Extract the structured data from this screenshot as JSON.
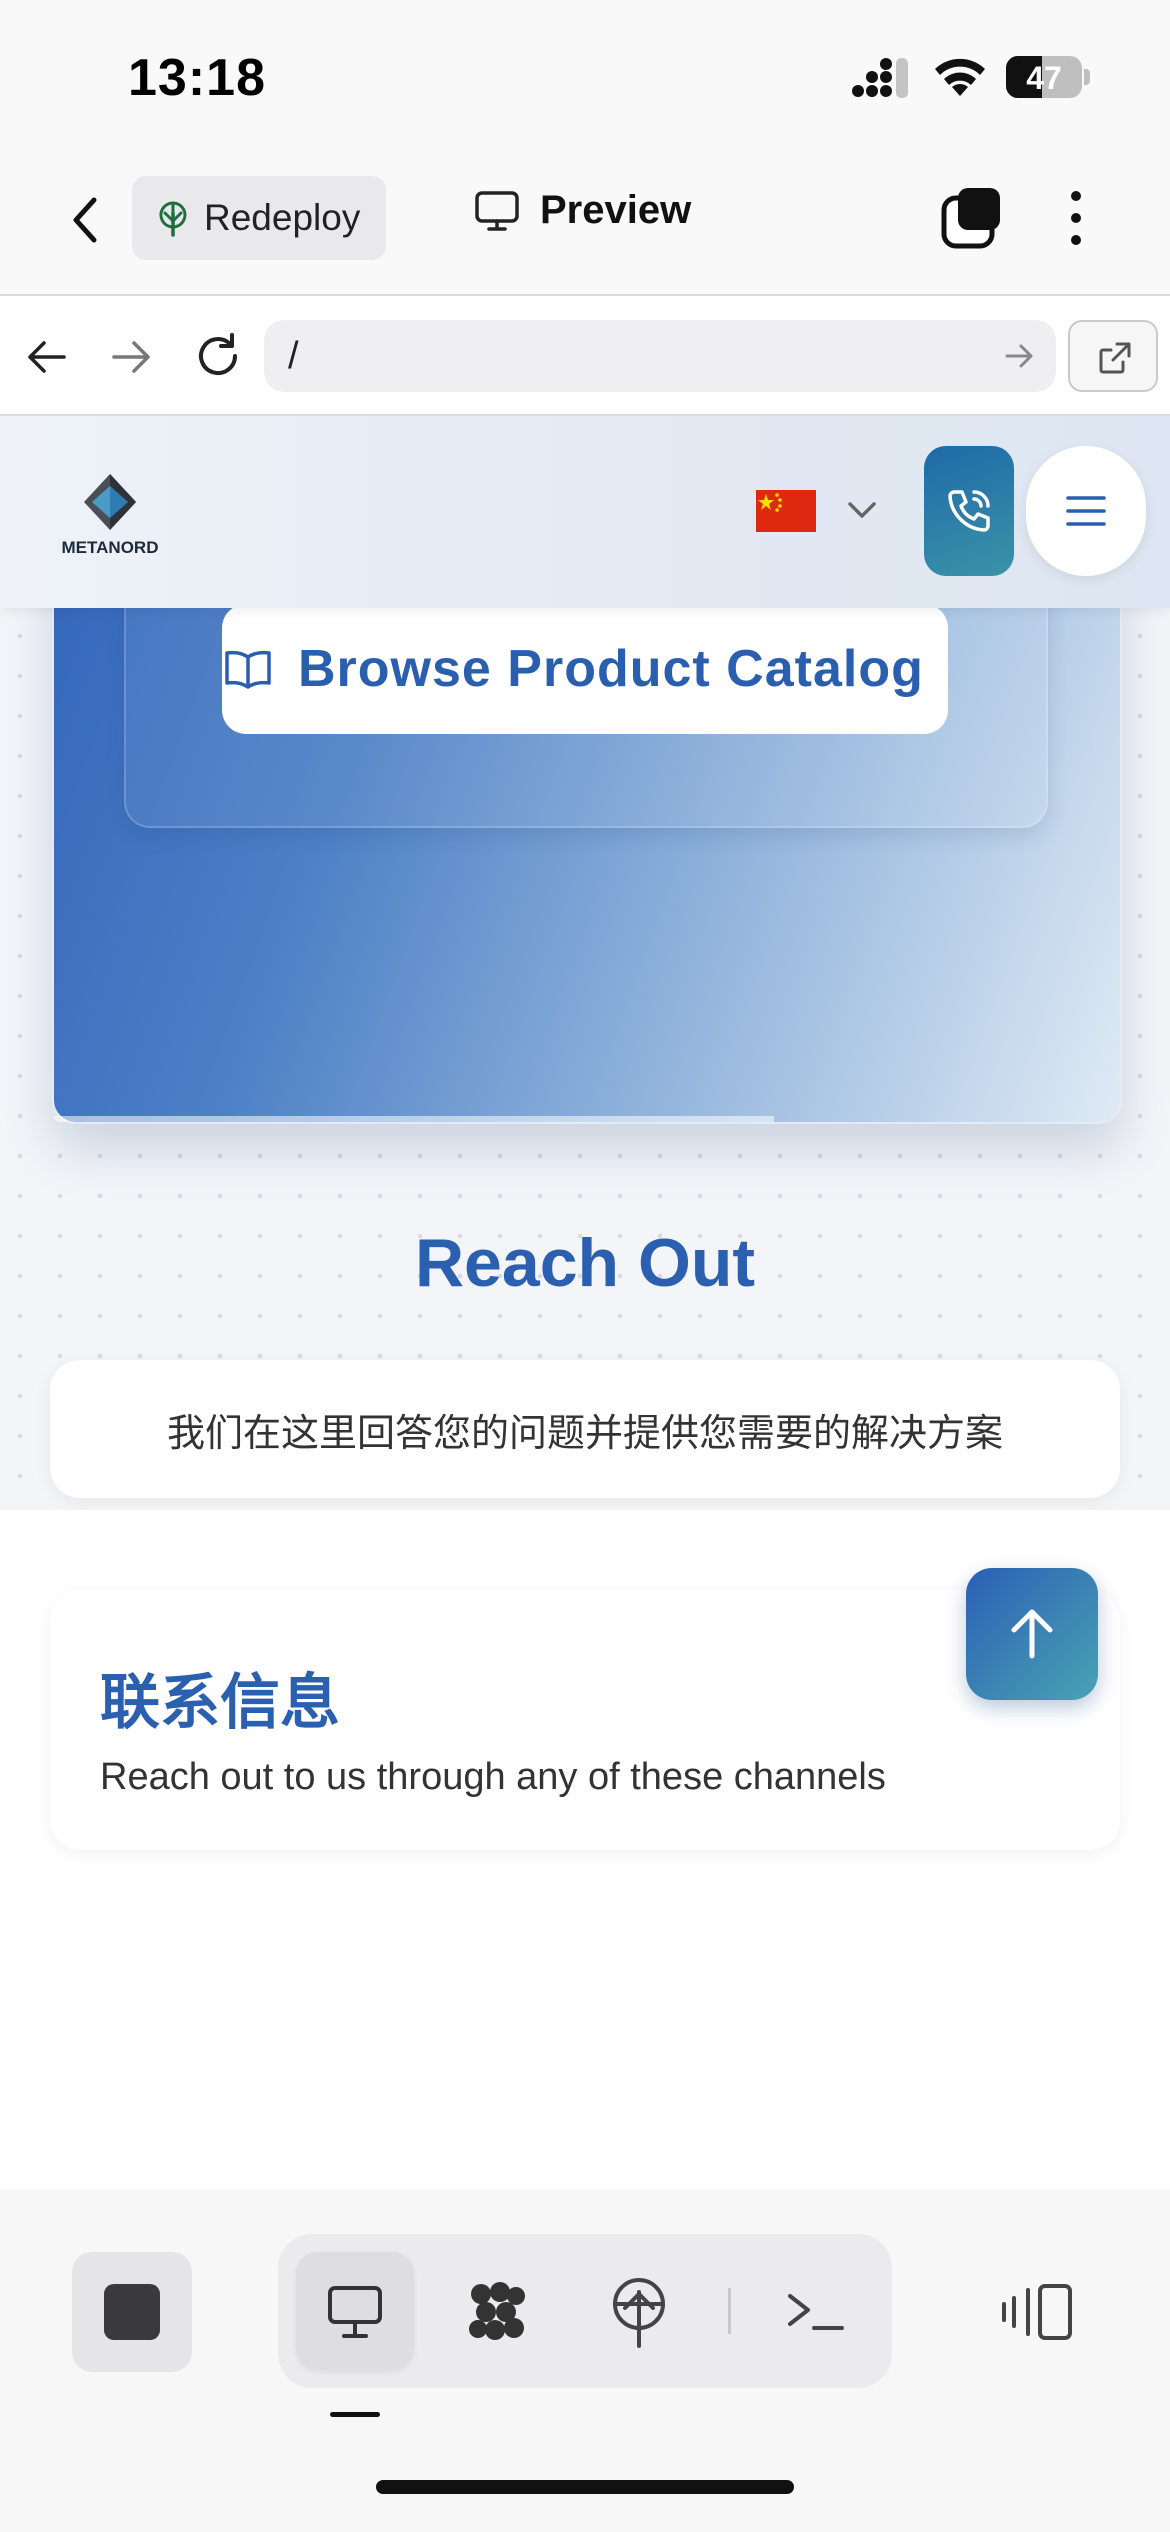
{
  "status_bar": {
    "time": "13:18",
    "battery": "47",
    "battery_level": 0.47
  },
  "app_bar": {
    "redeploy_label": "Redeploy",
    "preview_label": "Preview"
  },
  "browser": {
    "url": "/"
  },
  "site": {
    "logo_text": "METANORD",
    "language": "zh-CN",
    "hero": {
      "catalog_button": "Browse Product Catalog"
    },
    "contact": {
      "title": "Reach Out",
      "subtitle": "我们在这里回答您的问题并提供您需要的解决方案",
      "info_title": "联系信息",
      "info_desc": "Reach out to us through any of these channels"
    }
  },
  "colors": {
    "brand_blue": "#2b60b0",
    "flag_red": "#de2910",
    "flag_yellow": "#ffde00"
  },
  "icons": [
    "back-icon",
    "tree-icon",
    "monitor-icon",
    "tabs-icon",
    "more-icon",
    "arrow-left-icon",
    "arrow-right-icon",
    "reload-icon",
    "go-arrow-icon",
    "open-external-icon",
    "logo-diamond-icon",
    "china-flag-icon",
    "chevron-down-icon",
    "phone-icon",
    "menu-icon",
    "book-open-icon",
    "arrow-up-icon",
    "stop-icon",
    "desktop-icon",
    "apps-icon",
    "deploy-icon",
    "terminal-icon",
    "side-panel-icon"
  ]
}
